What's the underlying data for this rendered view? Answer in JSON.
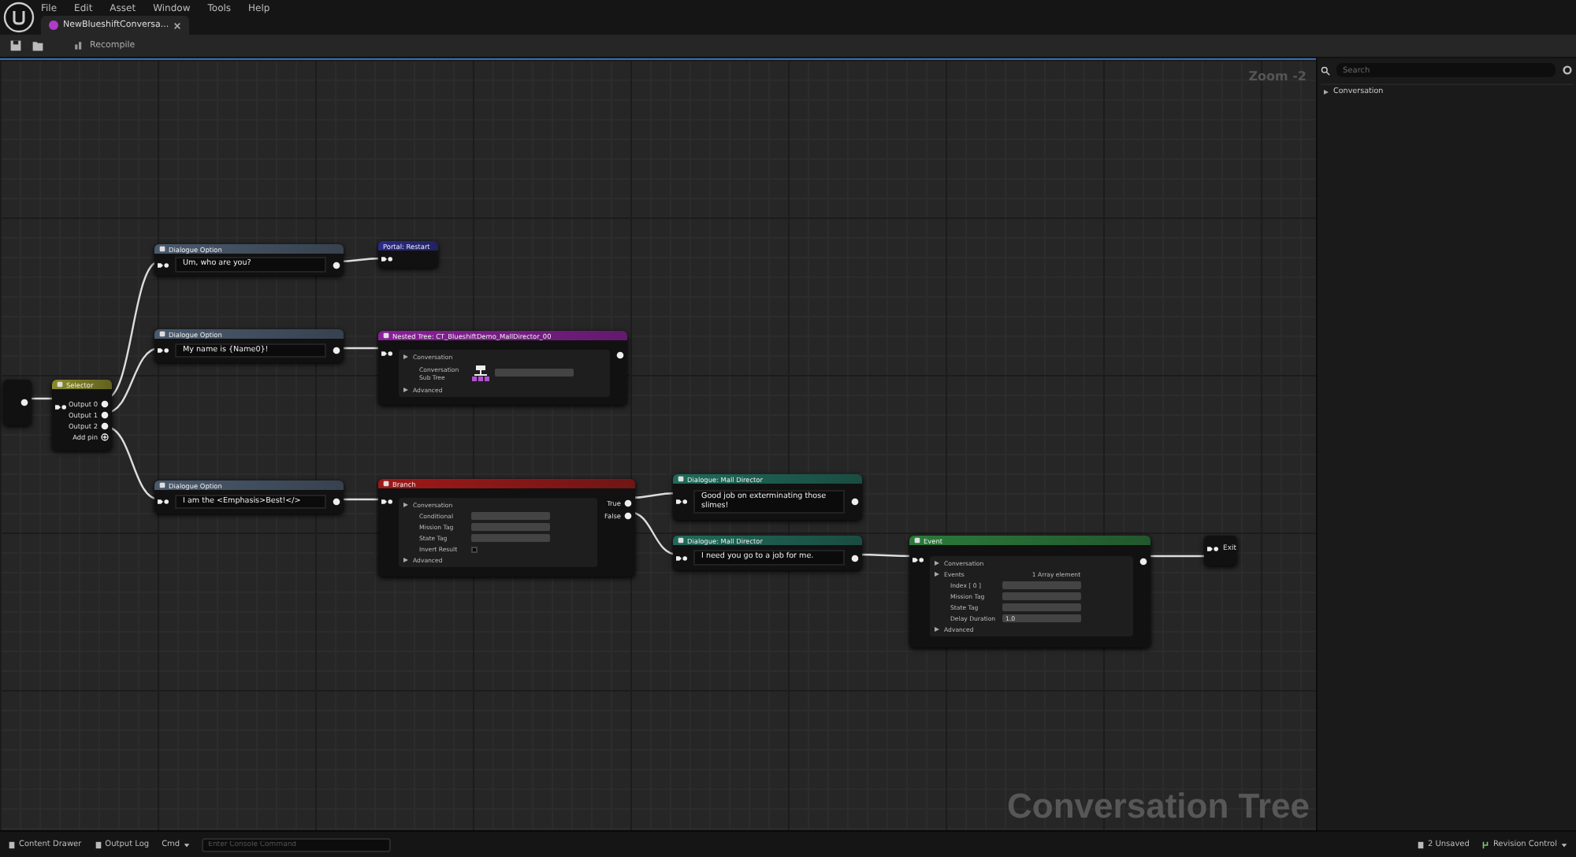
{
  "menu": [
    "File",
    "Edit",
    "Asset",
    "Window",
    "Tools",
    "Help"
  ],
  "tabs": [
    {
      "label": "NewBlueshiftConversa...",
      "selected": true,
      "color": "#b03cc8"
    }
  ],
  "toolbar": {
    "recompile": "Recompile"
  },
  "graph": {
    "zoom": "Zoom -2",
    "watermark": "Conversation Tree",
    "nodes": [
      {
        "kind": "entry"
      },
      {
        "kind": "selector",
        "title": "Selector",
        "color": "#8a8a28",
        "outputs": [
          "Output 0",
          "Output 1",
          "Output 2"
        ],
        "add_pin": "Add pin"
      },
      {
        "kind": "dialogue",
        "title": "Dialogue Option",
        "color": "#4a5a6e",
        "text": "Um, who are you?"
      },
      {
        "kind": "portal",
        "title": "Portal: Restart",
        "color": "#2a2a8a"
      },
      {
        "kind": "dialogue",
        "title": "Dialogue Option",
        "color": "#4a5a6e",
        "text": "My name is {Name0}!"
      },
      {
        "kind": "block",
        "title": "Nested Tree: CT_BlueshiftDemo_MallDirector_00",
        "color": "#8a1f9a",
        "rows": [
          {
            "kind": "section",
            "label": "Conversation"
          },
          {
            "kind": "asset",
            "label": "Conversation Sub Tree"
          },
          {
            "kind": "section",
            "label": "Advanced"
          }
        ]
      },
      {
        "kind": "dialogue",
        "title": "Dialogue Option",
        "color": "#4a5a6e",
        "text": "I am the <Emphasis>Best!</>"
      },
      {
        "kind": "block",
        "title": "Branch",
        "color": "#a01818",
        "outputs": [
          "True",
          "False"
        ],
        "rows": [
          {
            "kind": "section",
            "label": "Conversation"
          },
          {
            "kind": "field",
            "label": "Conditional"
          },
          {
            "kind": "field",
            "label": "Mission Tag"
          },
          {
            "kind": "field",
            "label": "State Tag"
          },
          {
            "kind": "check",
            "label": "Invert Result",
            "checked": false
          },
          {
            "kind": "section",
            "label": "Advanced"
          }
        ]
      },
      {
        "kind": "dialogue",
        "title": "Dialogue: Mall Director",
        "color": "#1f6a5a",
        "text": "Good job on exterminating those slimes!"
      },
      {
        "kind": "dialogue",
        "title": "Dialogue: Mall Director",
        "color": "#1f6a5a",
        "text": "I need you go to a job for me."
      },
      {
        "kind": "block",
        "title": "Event",
        "color": "#2a7a3a",
        "rows": [
          {
            "kind": "section",
            "label": "Conversation"
          },
          {
            "kind": "section",
            "label": "Events",
            "value": "1 Array element"
          },
          {
            "kind": "field",
            "label": "Index [ 0 ]"
          },
          {
            "kind": "field",
            "label": "Mission Tag"
          },
          {
            "kind": "field",
            "label": "State Tag"
          },
          {
            "kind": "field",
            "label": "Delay Duration",
            "value": "1.0"
          },
          {
            "kind": "section",
            "label": "Advanced"
          }
        ]
      },
      {
        "kind": "exit",
        "title": "Exit"
      }
    ]
  },
  "panel": {
    "search_placeholder": "Search",
    "tree": [
      {
        "label": "Conversation",
        "expanded": false
      }
    ]
  },
  "status_bar": {
    "left": [
      "Content Drawer",
      "Output Log"
    ],
    "cmd": "Cmd",
    "console_placeholder": "Enter Console Command",
    "unsaved": "2 Unsaved",
    "revision": "Revision Control"
  }
}
